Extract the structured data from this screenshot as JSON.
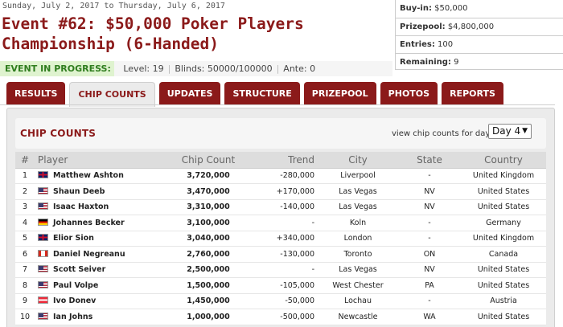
{
  "header": {
    "dates": "Sunday, July 2, 2017 to Thursday, July 6, 2017",
    "title": "Event #62: $50,000 Poker Players Championship (6-Handed)"
  },
  "status": {
    "label": "EVENT IN PROGRESS:",
    "level": "Level: 19",
    "blinds": "Blinds: 50000/100000",
    "ante": "Ante: 0"
  },
  "info": {
    "buyin_label": "Buy-in:",
    "buyin": "$50,000",
    "prizepool_label": "Prizepool:",
    "prizepool": "$4,800,000",
    "entries_label": "Entries:",
    "entries": "100",
    "remaining_label": "Remaining:",
    "remaining": "9"
  },
  "tabs": [
    "RESULTS",
    "CHIP COUNTS",
    "UPDATES",
    "STRUCTURE",
    "PRIZEPOOL",
    "PHOTOS",
    "REPORTS"
  ],
  "active_tab": "CHIP COUNTS",
  "panel": {
    "title": "CHIP COUNTS",
    "day_label": "view chip counts for day:",
    "day_value": "Day 4"
  },
  "table": {
    "headers": [
      "#",
      "Player",
      "Chip Count",
      "Trend",
      "City",
      "State",
      "Country"
    ],
    "rows": [
      {
        "rank": "1",
        "flag": "uk",
        "player": "Matthew Ashton",
        "chips": "3,720,000",
        "trend": "-280,000",
        "city": "Liverpool",
        "state": "-",
        "country": "United Kingdom"
      },
      {
        "rank": "2",
        "flag": "us",
        "player": "Shaun Deeb",
        "chips": "3,470,000",
        "trend": "+170,000",
        "city": "Las Vegas",
        "state": "NV",
        "country": "United States"
      },
      {
        "rank": "3",
        "flag": "us",
        "player": "Isaac Haxton",
        "chips": "3,310,000",
        "trend": "-140,000",
        "city": "Las Vegas",
        "state": "NV",
        "country": "United States"
      },
      {
        "rank": "4",
        "flag": "de",
        "player": "Johannes Becker",
        "chips": "3,100,000",
        "trend": "-",
        "city": "Koln",
        "state": "-",
        "country": "Germany"
      },
      {
        "rank": "5",
        "flag": "uk",
        "player": "Elior Sion",
        "chips": "3,040,000",
        "trend": "+340,000",
        "city": "London",
        "state": "-",
        "country": "United Kingdom"
      },
      {
        "rank": "6",
        "flag": "ca",
        "player": "Daniel Negreanu",
        "chips": "2,760,000",
        "trend": "-130,000",
        "city": "Toronto",
        "state": "ON",
        "country": "Canada"
      },
      {
        "rank": "7",
        "flag": "us",
        "player": "Scott Seiver",
        "chips": "2,500,000",
        "trend": "-",
        "city": "Las Vegas",
        "state": "NV",
        "country": "United States"
      },
      {
        "rank": "8",
        "flag": "us",
        "player": "Paul Volpe",
        "chips": "1,500,000",
        "trend": "-105,000",
        "city": "West Chester",
        "state": "PA",
        "country": "United States"
      },
      {
        "rank": "9",
        "flag": "at",
        "player": "Ivo Donev",
        "chips": "1,450,000",
        "trend": "-50,000",
        "city": "Lochau",
        "state": "-",
        "country": "Austria"
      },
      {
        "rank": "10",
        "flag": "us",
        "player": "Ian Johns",
        "chips": "1,000,000",
        "trend": "-500,000",
        "city": "Newcastle",
        "state": "WA",
        "country": "United States"
      }
    ]
  },
  "colors": {
    "brand": "#8b1a1a",
    "negative": "#d40000",
    "positive": "#1c8a1c",
    "progress_green": "#2f7d1e"
  }
}
